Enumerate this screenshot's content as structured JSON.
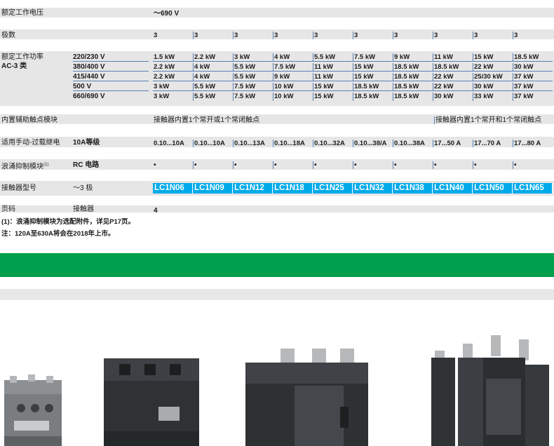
{
  "rated_voltage": {
    "label": "额定工作电压",
    "value": "～690 V"
  },
  "poles": {
    "label": "极数",
    "values": [
      "3",
      "3",
      "3",
      "3",
      "3",
      "3",
      "3",
      "3",
      "3",
      "3"
    ]
  },
  "rated_power": {
    "label_line1": "额定工作功率",
    "label_line2": "AC-3 类",
    "voltages": [
      "220/230 V",
      "380/400 V",
      "415/440 V",
      "500 V",
      "660/690 V"
    ],
    "rows": [
      [
        "1.5 kW",
        "2.2 kW",
        "3 kW",
        "4 kW",
        "5.5 kW",
        "7.5 kW",
        "9 kW",
        "11 kW",
        "15 kW",
        "18.5 kW"
      ],
      [
        "2.2 kW",
        "4 kW",
        "5.5 kW",
        "7.5 kW",
        "11 kW",
        "15 kW",
        "18.5 kW",
        "18.5 kW",
        "22 kW",
        "30 kW"
      ],
      [
        "2.2 kW",
        "4 kW",
        "5.5 kW",
        "9 kW",
        "11 kW",
        "15 kW",
        "18.5 kW",
        "22 kW",
        "25/30 kW",
        "37 kW"
      ],
      [
        "3 kW",
        "5.5 kW",
        "7.5 kW",
        "10 kW",
        "15 kW",
        "18.5 kW",
        "18.5 kW",
        "22 kW",
        "30 kW",
        "37 kW"
      ],
      [
        "3 kW",
        "5.5 kW",
        "7.5 kW",
        "10 kW",
        "15 kW",
        "18.5 kW",
        "18.5 kW",
        "30 kW",
        "33 kW",
        "37 kW"
      ]
    ]
  },
  "aux_contacts": {
    "label": "内置辅助触点模块",
    "value_a": "接触器内置1个常开或1个常闭触点",
    "value_b": "接触器内置1个常开和1个常闭触点"
  },
  "overload_relay": {
    "label": "适用手动-过载继电",
    "class": "10A等级",
    "values": [
      "0.10...10A",
      "0.10...10A",
      "0.10...13A",
      "0.10...18A",
      "0.10...32A",
      "0.10...38/A",
      "0.10...38A",
      "17...50 A",
      "17...70 A",
      "17...80 A"
    ]
  },
  "surge": {
    "label": "浪涌抑制模块",
    "sup": "(1)",
    "type": "RC 电路",
    "dot": "•"
  },
  "model": {
    "label": "接触器型号",
    "poles": "～3 极",
    "values": [
      "LC1N06",
      "LC1N09",
      "LC1N12",
      "LC1N18",
      "LC1N25",
      "LC1N32",
      "LC1N38",
      "LC1N40",
      "LC1N50",
      "LC1N65"
    ]
  },
  "page": {
    "label": "页码",
    "sub": "接触器",
    "value": "4"
  },
  "notes": [
    "(1)：浪涌抑制模块为选配附件，详见P17页。",
    "注：120A至630A将会在2018年上市。"
  ],
  "colors": {
    "accent": "#00aaea",
    "green": "#009f4d",
    "band": "#e6e6e6"
  }
}
